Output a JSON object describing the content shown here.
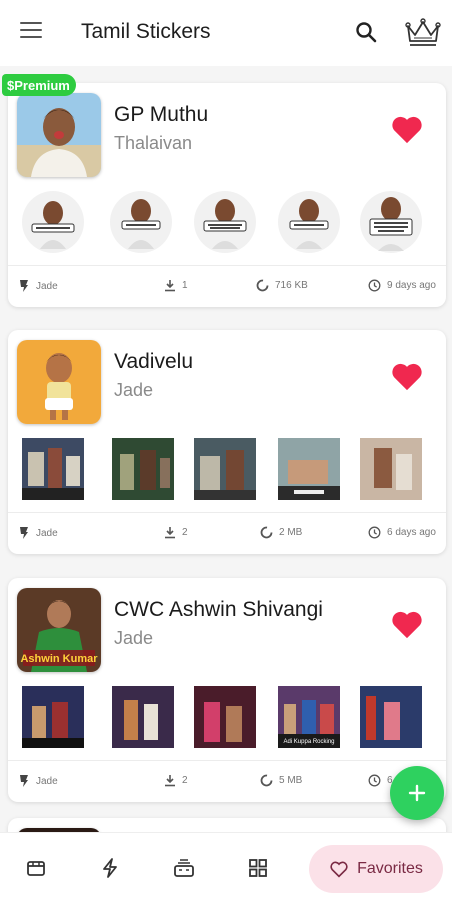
{
  "app": {
    "title": "Tamil Stickers"
  },
  "packs": [
    {
      "name": "GP Muthu",
      "author": "Thalaivan",
      "premium_label": "Premium",
      "meta": {
        "publisher": "Jade",
        "downloads": "1",
        "size": "716 KB",
        "updated": "9 days ago"
      }
    },
    {
      "name": "Vadivelu",
      "author": "Jade",
      "meta": {
        "publisher": "Jade",
        "downloads": "2",
        "size": "2 MB",
        "updated": "6 days ago"
      }
    },
    {
      "name": "CWC Ashwin Shivangi",
      "author": "Jade",
      "thumb_caption": "Ashwin Kumar",
      "sticker_captions": [
        "Adi Kuppa Rocking"
      ],
      "meta": {
        "publisher": "Jade",
        "downloads": "2",
        "size": "5 MB",
        "updated": "6"
      }
    }
  ],
  "bottom_nav": {
    "favorites_label": "Favorites"
  },
  "colors": {
    "heart": "#f0284f",
    "premium": "#2ecc40",
    "fab": "#2ed15f",
    "favorites_pill": "#fbe1e8"
  },
  "icons": [
    "menu-icon",
    "search-icon",
    "crown-icon",
    "heart-icon",
    "publisher-icon",
    "download-icon",
    "size-icon",
    "clock-icon",
    "add-icon",
    "store-icon",
    "flash-icon",
    "stack-icon",
    "grid-icon",
    "heart-outline-icon"
  ]
}
